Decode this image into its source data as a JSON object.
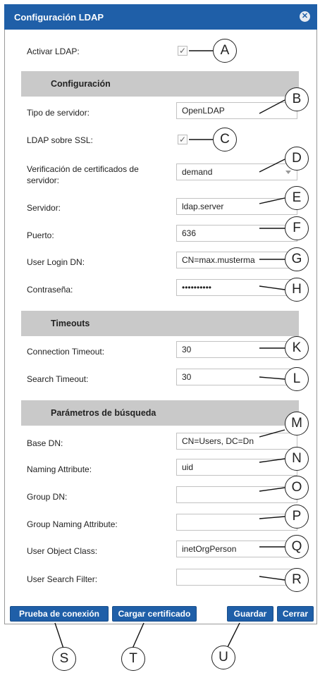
{
  "window": {
    "title": "Configuración LDAP"
  },
  "general": {
    "activar_label": "Activar LDAP:",
    "activar_checked": true
  },
  "config_section": {
    "title": "Configuración",
    "tipo_label": "Tipo de servidor:",
    "tipo_value": "OpenLDAP",
    "ssl_label": "LDAP sobre SSL:",
    "ssl_checked": true,
    "verif_label": "Verificación de certificados de servidor:",
    "verif_value": "demand",
    "servidor_label": "Servidor:",
    "servidor_value": "ldap.server",
    "puerto_label": "Puerto:",
    "puerto_value": "636",
    "userdn_label": "User Login DN:",
    "userdn_value": "CN=max.musterma",
    "password_label": "Contraseña:",
    "password_value": "••••••••••"
  },
  "timeouts": {
    "title": "Timeouts",
    "conn_label": "Connection Timeout:",
    "conn_value": "30",
    "search_label": "Search Timeout:",
    "search_value": "30"
  },
  "search_params": {
    "title": "Parámetros de búsqueda",
    "basedn_label": "Base DN:",
    "basedn_value": "CN=Users, DC=Dn",
    "naming_label": "Naming Attribute:",
    "naming_value": "uid",
    "groupdn_label": "Group DN:",
    "groupdn_value": "",
    "groupnaming_label": "Group Naming Attribute:",
    "groupnaming_value": "",
    "objclass_label": "User Object Class:",
    "objclass_value": "inetOrgPerson",
    "filter_label": "User Search Filter:",
    "filter_value": ""
  },
  "buttons": {
    "test": "Prueba de conexión",
    "cert": "Cargar certificado",
    "save": "Guardar",
    "close": "Cerrar"
  },
  "callouts": [
    "A",
    "B",
    "C",
    "D",
    "E",
    "F",
    "G",
    "H",
    "K",
    "L",
    "M",
    "N",
    "O",
    "P",
    "Q",
    "R",
    "S",
    "T",
    "U"
  ]
}
